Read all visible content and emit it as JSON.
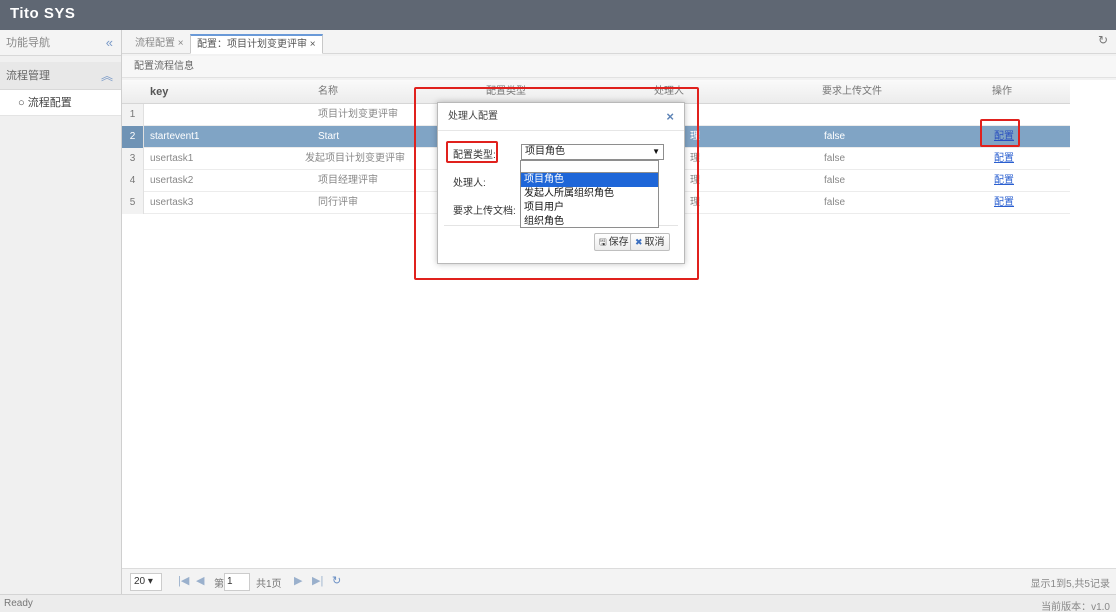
{
  "app": {
    "title": "Tito SYS"
  },
  "sidebar": {
    "nav_label": "功能导航",
    "collapse_icon": "«",
    "group_label": "流程管理",
    "group_icon": "︽",
    "item_label": "○ 流程配置"
  },
  "tabs": [
    {
      "label": "流程配置 ×",
      "active": false
    },
    {
      "label": "配置：项目计划变更评审 ×",
      "active": true
    }
  ],
  "refresh_icon": "↻",
  "panel": {
    "title": "配置流程信息"
  },
  "grid": {
    "columns": [
      "key",
      "名称",
      "配置类型",
      "处理人",
      "要求上传文件",
      "操作"
    ],
    "rows": [
      {
        "num": "1",
        "key": "",
        "name": "项目计划变更评审",
        "type": "",
        "handler": "",
        "upload": "",
        "op": ""
      },
      {
        "num": "2",
        "key": "startevent1",
        "name": "Start",
        "type": "",
        "handler": "理",
        "upload": "false",
        "op": "配置",
        "selected": true
      },
      {
        "num": "3",
        "key": "usertask1",
        "name": "发起项目计划变更评审",
        "type": "",
        "handler": "理",
        "upload": "false",
        "op": "配置"
      },
      {
        "num": "4",
        "key": "usertask2",
        "name": "项目经理评审",
        "type": "",
        "handler": "理",
        "upload": "false",
        "op": "配置"
      },
      {
        "num": "5",
        "key": "usertask3",
        "name": "同行评审",
        "type": "",
        "handler": "理",
        "upload": "false",
        "op": "配置"
      }
    ]
  },
  "pager": {
    "page_size": "20 ▾",
    "first": "|◀",
    "prev": "◀",
    "page_label": "第",
    "page_value": "1",
    "total_pages": "共1页",
    "next": "▶",
    "last": "▶|",
    "reload": "↻",
    "info": "显示1到5,共5记录"
  },
  "status": {
    "left": "Ready",
    "right": "当前版本：v1.0"
  },
  "dialog": {
    "title": "处理人配置",
    "close": "×",
    "type_label": "配置类型:",
    "type_value": "项目角色",
    "select_arrow": "▼",
    "handler_label": "处理人:",
    "upload_label": "要求上传文档:",
    "save_icon": "🖫",
    "save": "保存",
    "cancel_icon": "✖",
    "cancel": "取消",
    "options": [
      "项目角色",
      "发起人所属组织角色",
      "项目用户",
      "组织角色"
    ],
    "selected_option": "项目角色"
  },
  "colors": {
    "accent": "#e0211d",
    "selected_row": "#80a4c5",
    "topbar": "#5f6773",
    "option_highlight": "#1e66d8"
  }
}
